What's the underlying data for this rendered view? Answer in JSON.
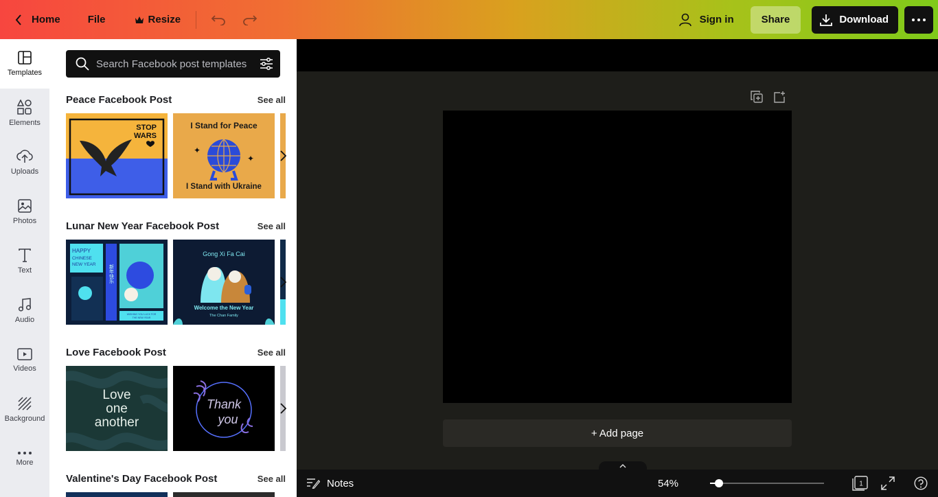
{
  "topbar": {
    "home_label": "Home",
    "file_label": "File",
    "resize_label": "Resize",
    "signin_label": "Sign in",
    "share_label": "Share",
    "download_label": "Download"
  },
  "rail": {
    "items": [
      {
        "label": "Templates"
      },
      {
        "label": "Elements"
      },
      {
        "label": "Uploads"
      },
      {
        "label": "Photos"
      },
      {
        "label": "Text"
      },
      {
        "label": "Audio"
      },
      {
        "label": "Videos"
      },
      {
        "label": "Background"
      },
      {
        "label": "More"
      }
    ]
  },
  "search": {
    "placeholder": "Search Facebook post templates"
  },
  "sections": [
    {
      "title": "Peace Facebook Post",
      "see_all": "See all",
      "thumbs": [
        {
          "text": [
            "STOP",
            "WARS"
          ]
        },
        {
          "text": [
            "I Stand for Peace",
            "I Stand with Ukraine"
          ]
        }
      ]
    },
    {
      "title": "Lunar New Year Facebook Post",
      "see_all": "See all",
      "thumbs": [
        {
          "text": [
            "HAPPY",
            "CHINESE",
            "NEW YEAR",
            "新年快乐",
            "WISHING YOU LUCK FOR",
            "THE NEW YEAR"
          ]
        },
        {
          "text": [
            "Gong Xi Fa Cai",
            "Welcome the New Year",
            "The Chan Family"
          ]
        }
      ]
    },
    {
      "title": "Love Facebook Post",
      "see_all": "See all",
      "thumbs": [
        {
          "text": [
            "Love",
            "one",
            "another"
          ]
        },
        {
          "text": [
            "Thank",
            "you"
          ]
        }
      ]
    },
    {
      "title": "Valentine's Day Facebook Post",
      "see_all": "See all"
    }
  ],
  "canvas": {
    "add_page_label": "+ Add page"
  },
  "bottombar": {
    "notes_label": "Notes",
    "zoom_label": "54%",
    "zoom_fraction": 0.08,
    "page_count": "1"
  },
  "colors": {
    "accent_dark": "#111111",
    "rail_bg": "#ebecf0",
    "workspace_bg": "#1e1e1a"
  },
  "icons": [
    "chevron-left-icon",
    "crown-icon",
    "undo-icon",
    "redo-icon",
    "user-icon",
    "download-icon",
    "more-dots-icon",
    "search-icon",
    "filter-icon",
    "chevron-right-icon",
    "duplicate-page-icon",
    "add-page-icon",
    "notes-icon",
    "chevron-up-icon",
    "page-count-icon",
    "fullscreen-icon",
    "help-icon"
  ]
}
